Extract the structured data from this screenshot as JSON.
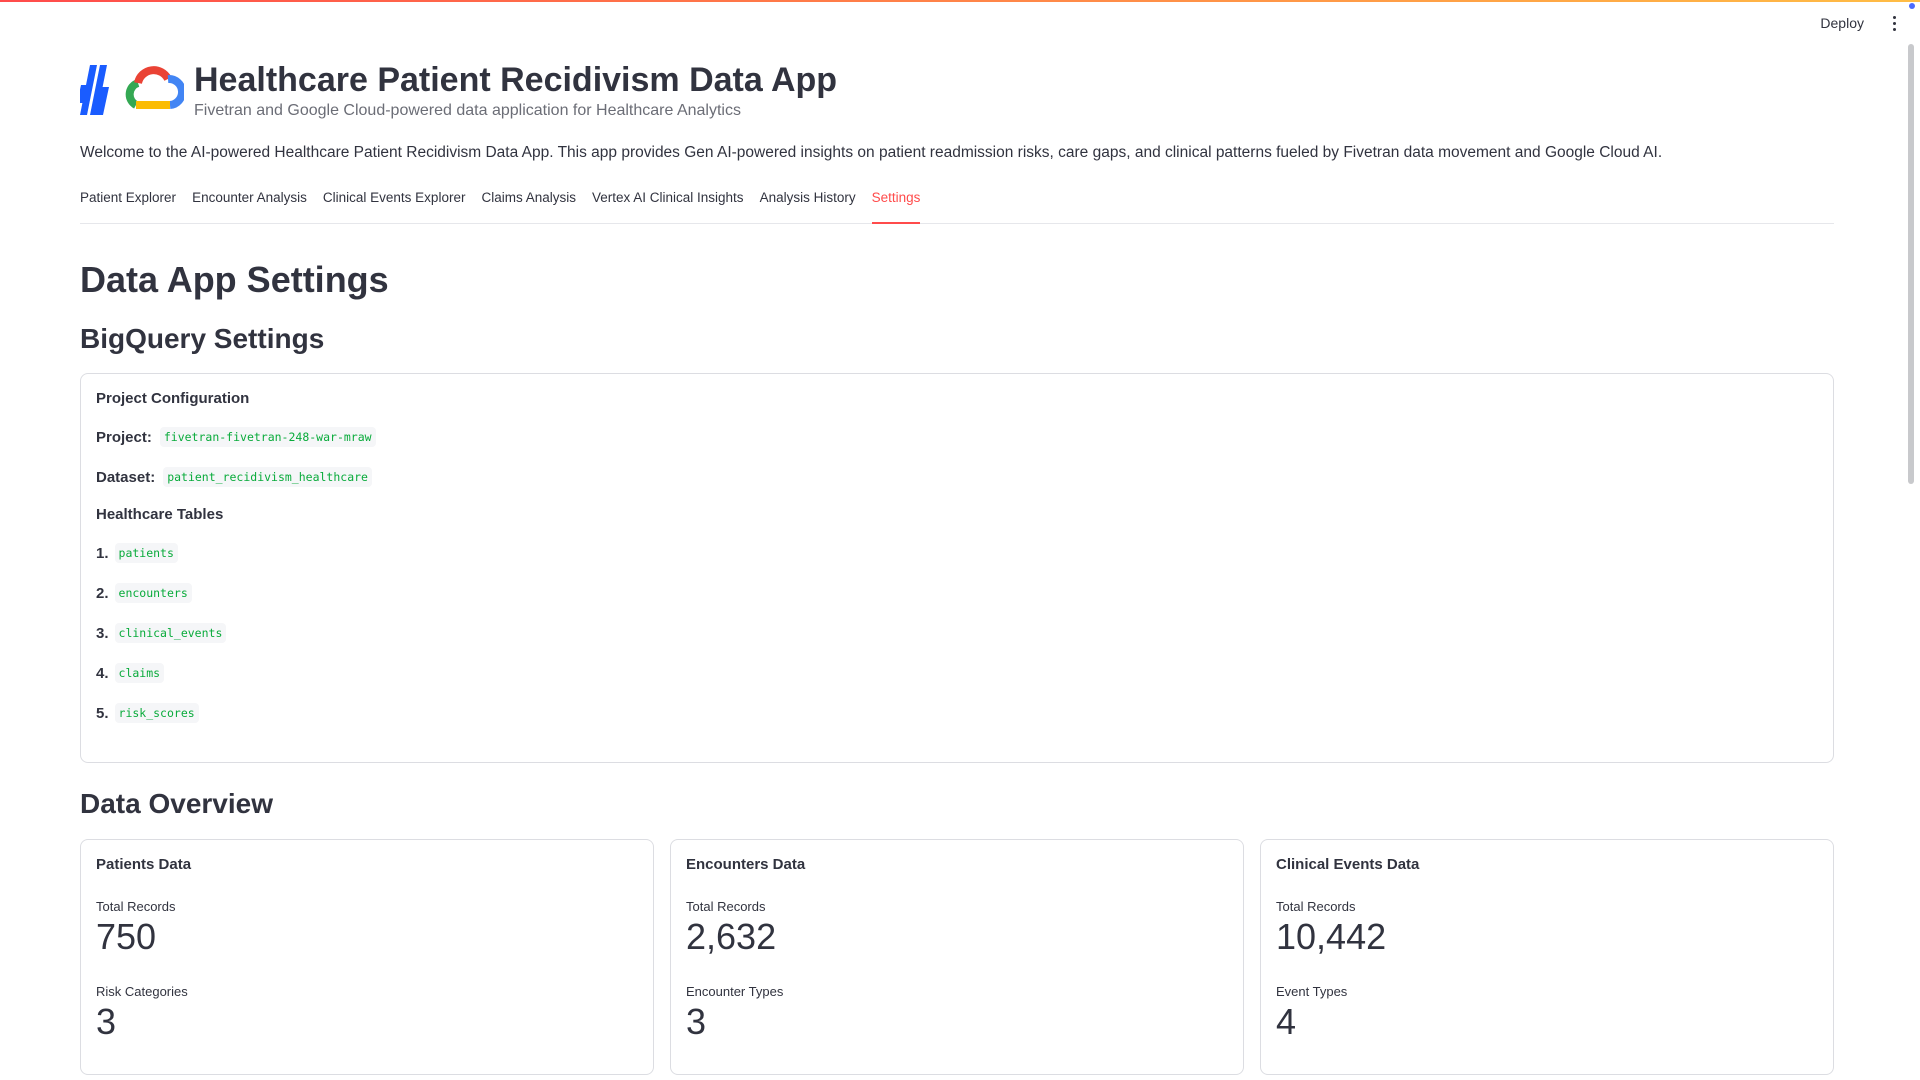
{
  "header": {
    "deploy_label": "Deploy",
    "menu_icon": "more-vert-icon"
  },
  "app": {
    "title": "Healthcare Patient Recidivism Data App",
    "subtitle": "Fivetran and Google Cloud-powered data application for Healthcare Analytics",
    "welcome": "Welcome to the AI-powered Healthcare Patient Recidivism Data App. This app provides Gen AI-powered insights on patient readmission risks, care gaps, and clinical patterns fueled by Fivetran data movement and Google Cloud AI."
  },
  "tabs": [
    {
      "label": "Patient Explorer"
    },
    {
      "label": "Encounter Analysis"
    },
    {
      "label": "Clinical Events Explorer"
    },
    {
      "label": "Claims Analysis"
    },
    {
      "label": "Vertex AI Clinical Insights"
    },
    {
      "label": "Analysis History"
    },
    {
      "label": "Settings"
    }
  ],
  "active_tab": "Settings",
  "page": {
    "title": "Data App Settings",
    "bigquery_heading": "BigQuery Settings",
    "overview_heading": "Data Overview"
  },
  "bigquery": {
    "config_label": "Project Configuration",
    "project_label": "Project:",
    "project_value": "fivetran-fivetran-248-war-mraw",
    "dataset_label": "Dataset:",
    "dataset_value": "patient_recidivism_healthcare",
    "tables_label": "Healthcare Tables",
    "tables": [
      {
        "num": "1.",
        "name": "patients"
      },
      {
        "num": "2.",
        "name": "encounters"
      },
      {
        "num": "3.",
        "name": "clinical_events"
      },
      {
        "num": "4.",
        "name": "claims"
      },
      {
        "num": "5.",
        "name": "risk_scores"
      }
    ]
  },
  "overview": [
    {
      "title": "Patients Data",
      "metric1_label": "Total Records",
      "metric1_value": "750",
      "metric2_label": "Risk Categories",
      "metric2_value": "3"
    },
    {
      "title": "Encounters Data",
      "metric1_label": "Total Records",
      "metric1_value": "2,632",
      "metric2_label": "Encounter Types",
      "metric2_value": "3"
    },
    {
      "title": "Clinical Events Data",
      "metric1_label": "Total Records",
      "metric1_value": "10,442",
      "metric2_label": "Event Types",
      "metric2_value": "4"
    }
  ],
  "colors": {
    "accent": "#ff4b4b",
    "code_text": "#09ab3b",
    "text": "#31333f"
  }
}
